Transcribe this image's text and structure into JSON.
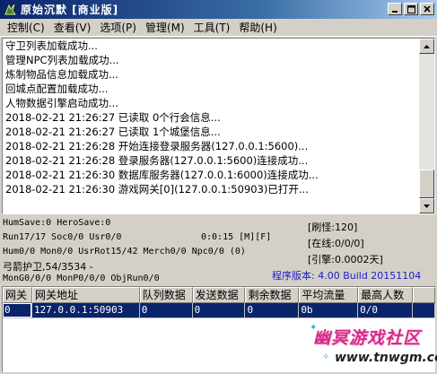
{
  "window": {
    "title": "原始沉默 [商业版]",
    "buttons": [
      "0",
      "1",
      "r"
    ]
  },
  "menu": [
    {
      "label": "控制(C)"
    },
    {
      "label": "查看(V)"
    },
    {
      "label": "选项(P)"
    },
    {
      "label": "管理(M)"
    },
    {
      "label": "工具(T)"
    },
    {
      "label": "帮助(H)"
    }
  ],
  "log": [
    "守卫列表加载成功...",
    "管理NPC列表加载成功...",
    "炼制物品信息加载成功...",
    "回城点配置加载成功...",
    "人物数据引擎启动成功...",
    "2018-02-21 21:26:27 已读取 0个行会信息...",
    "2018-02-21 21:26:27 已读取 1个城堡信息...",
    "2018-02-21 21:26:28 开始连接登录服务器(127.0.0.1:5600)...",
    "2018-02-21 21:26:28 登录服务器(127.0.0.1:5600)连接成功...",
    "2018-02-21 21:26:30 数据库服务器(127.0.0.1:6000)连接成功...",
    "2018-02-21 21:26:30 游戏网关[0](127.0.0.1:50903)已打开..."
  ],
  "status": {
    "line1": "HumSave:0 HeroSave:0",
    "line2": "Run17/17 Soc0/0 Usr0/0",
    "line3": "Hum0/0 Mon0/0 UsrRot15/42 Merch0/0 Npc0/0 (0)",
    "line4": "弓箭护卫,54/3534 -",
    "line5": "MonG0/0/0 MonP0/0/0 ObjRun0/0",
    "timer": "0:0:15 [M][F]",
    "refresh": "[刷怪:120]",
    "online": "[在线:0/0/0]",
    "engine": "[引擎:0.0002天]",
    "version": "程序版本: 4.00 Build 20151104"
  },
  "gateway_table": {
    "columns": [
      "网关",
      "网关地址",
      "队列数据",
      "发送数据",
      "剩余数据",
      "平均流量",
      "最高人数",
      ""
    ],
    "rows": [
      [
        "0",
        "127.0.0.1:50903",
        "0",
        "0",
        "0",
        "0b",
        "0/0",
        ""
      ]
    ]
  },
  "watermark": {
    "title": "幽冥游戏社区",
    "url": "www.tnwgm.com"
  },
  "colors": {
    "title_bar": "#0a246a",
    "selection": "#0a246a",
    "version_text": "#1c1cc8",
    "watermark": "#d62a8a"
  }
}
